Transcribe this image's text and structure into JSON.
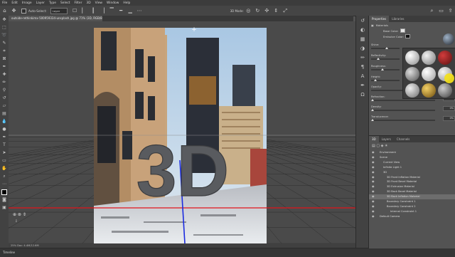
{
  "menu": [
    "File",
    "Edit",
    "Image",
    "Layer",
    "Type",
    "Select",
    "Filter",
    "3D",
    "View",
    "Window",
    "Help"
  ],
  "options_bar": {
    "home_icon": "home-icon",
    "tool_icon": "move-tool-icon",
    "auto_select_label": "Auto-Select:",
    "auto_select_value": "Layer",
    "mode_label": "3D Mode:"
  },
  "document": {
    "tab_title": "outside-rethinkimx-500959334-unsplash.jpg @ 71% (3D, RGB/8) *",
    "status": "25%    Doc: 4.4M/12.6M"
  },
  "canvas": {
    "text3d": "3D",
    "top_marker": "+"
  },
  "timeline": {
    "label": "Timeline"
  },
  "properties": {
    "tabs": [
      "Properties",
      "Libraries"
    ],
    "section": "Materials",
    "base_color_label": "Base Color:",
    "emissive_color_label": "Emissive Color:",
    "sliders": [
      {
        "label": "Shine:",
        "value": ""
      },
      {
        "label": "Reflectivity:",
        "value": ""
      },
      {
        "label": "Roughness:",
        "value": ""
      },
      {
        "label": "Height:",
        "value": ""
      },
      {
        "label": "Opacity:",
        "value": "100%"
      },
      {
        "label": "Refraction:",
        "value": "1.000"
      },
      {
        "label": "Density:",
        "value": "0%"
      },
      {
        "label": "Translucence:",
        "value": "0%"
      }
    ],
    "colors": {
      "accent": "#f3e11a"
    }
  },
  "layers": {
    "tabs": [
      "3D",
      "Layers",
      "Channels"
    ],
    "items": [
      {
        "name": "Environment",
        "indent": 1,
        "selected": false
      },
      {
        "name": "Scene",
        "indent": 1,
        "selected": false
      },
      {
        "name": "Current View",
        "indent": 2,
        "selected": false
      },
      {
        "name": "Infinite Light 1",
        "indent": 2,
        "selected": false
      },
      {
        "name": "3D",
        "indent": 2,
        "selected": false
      },
      {
        "name": "3D Front Inflation Material",
        "indent": 3,
        "selected": false
      },
      {
        "name": "3D Front Bevel Material",
        "indent": 3,
        "selected": false
      },
      {
        "name": "3D Extrusion Material",
        "indent": 3,
        "selected": false
      },
      {
        "name": "3D Back Bevel Material",
        "indent": 3,
        "selected": false
      },
      {
        "name": "3D Back Inflation Material",
        "indent": 3,
        "selected": true
      },
      {
        "name": "Boundary Constraint 1",
        "indent": 3,
        "selected": false
      },
      {
        "name": "Boundary Constraint 2",
        "indent": 3,
        "selected": false
      },
      {
        "name": "Internal Constraint 1",
        "indent": 4,
        "selected": false
      },
      {
        "name": "Default Camera",
        "indent": 1,
        "selected": false
      }
    ]
  }
}
